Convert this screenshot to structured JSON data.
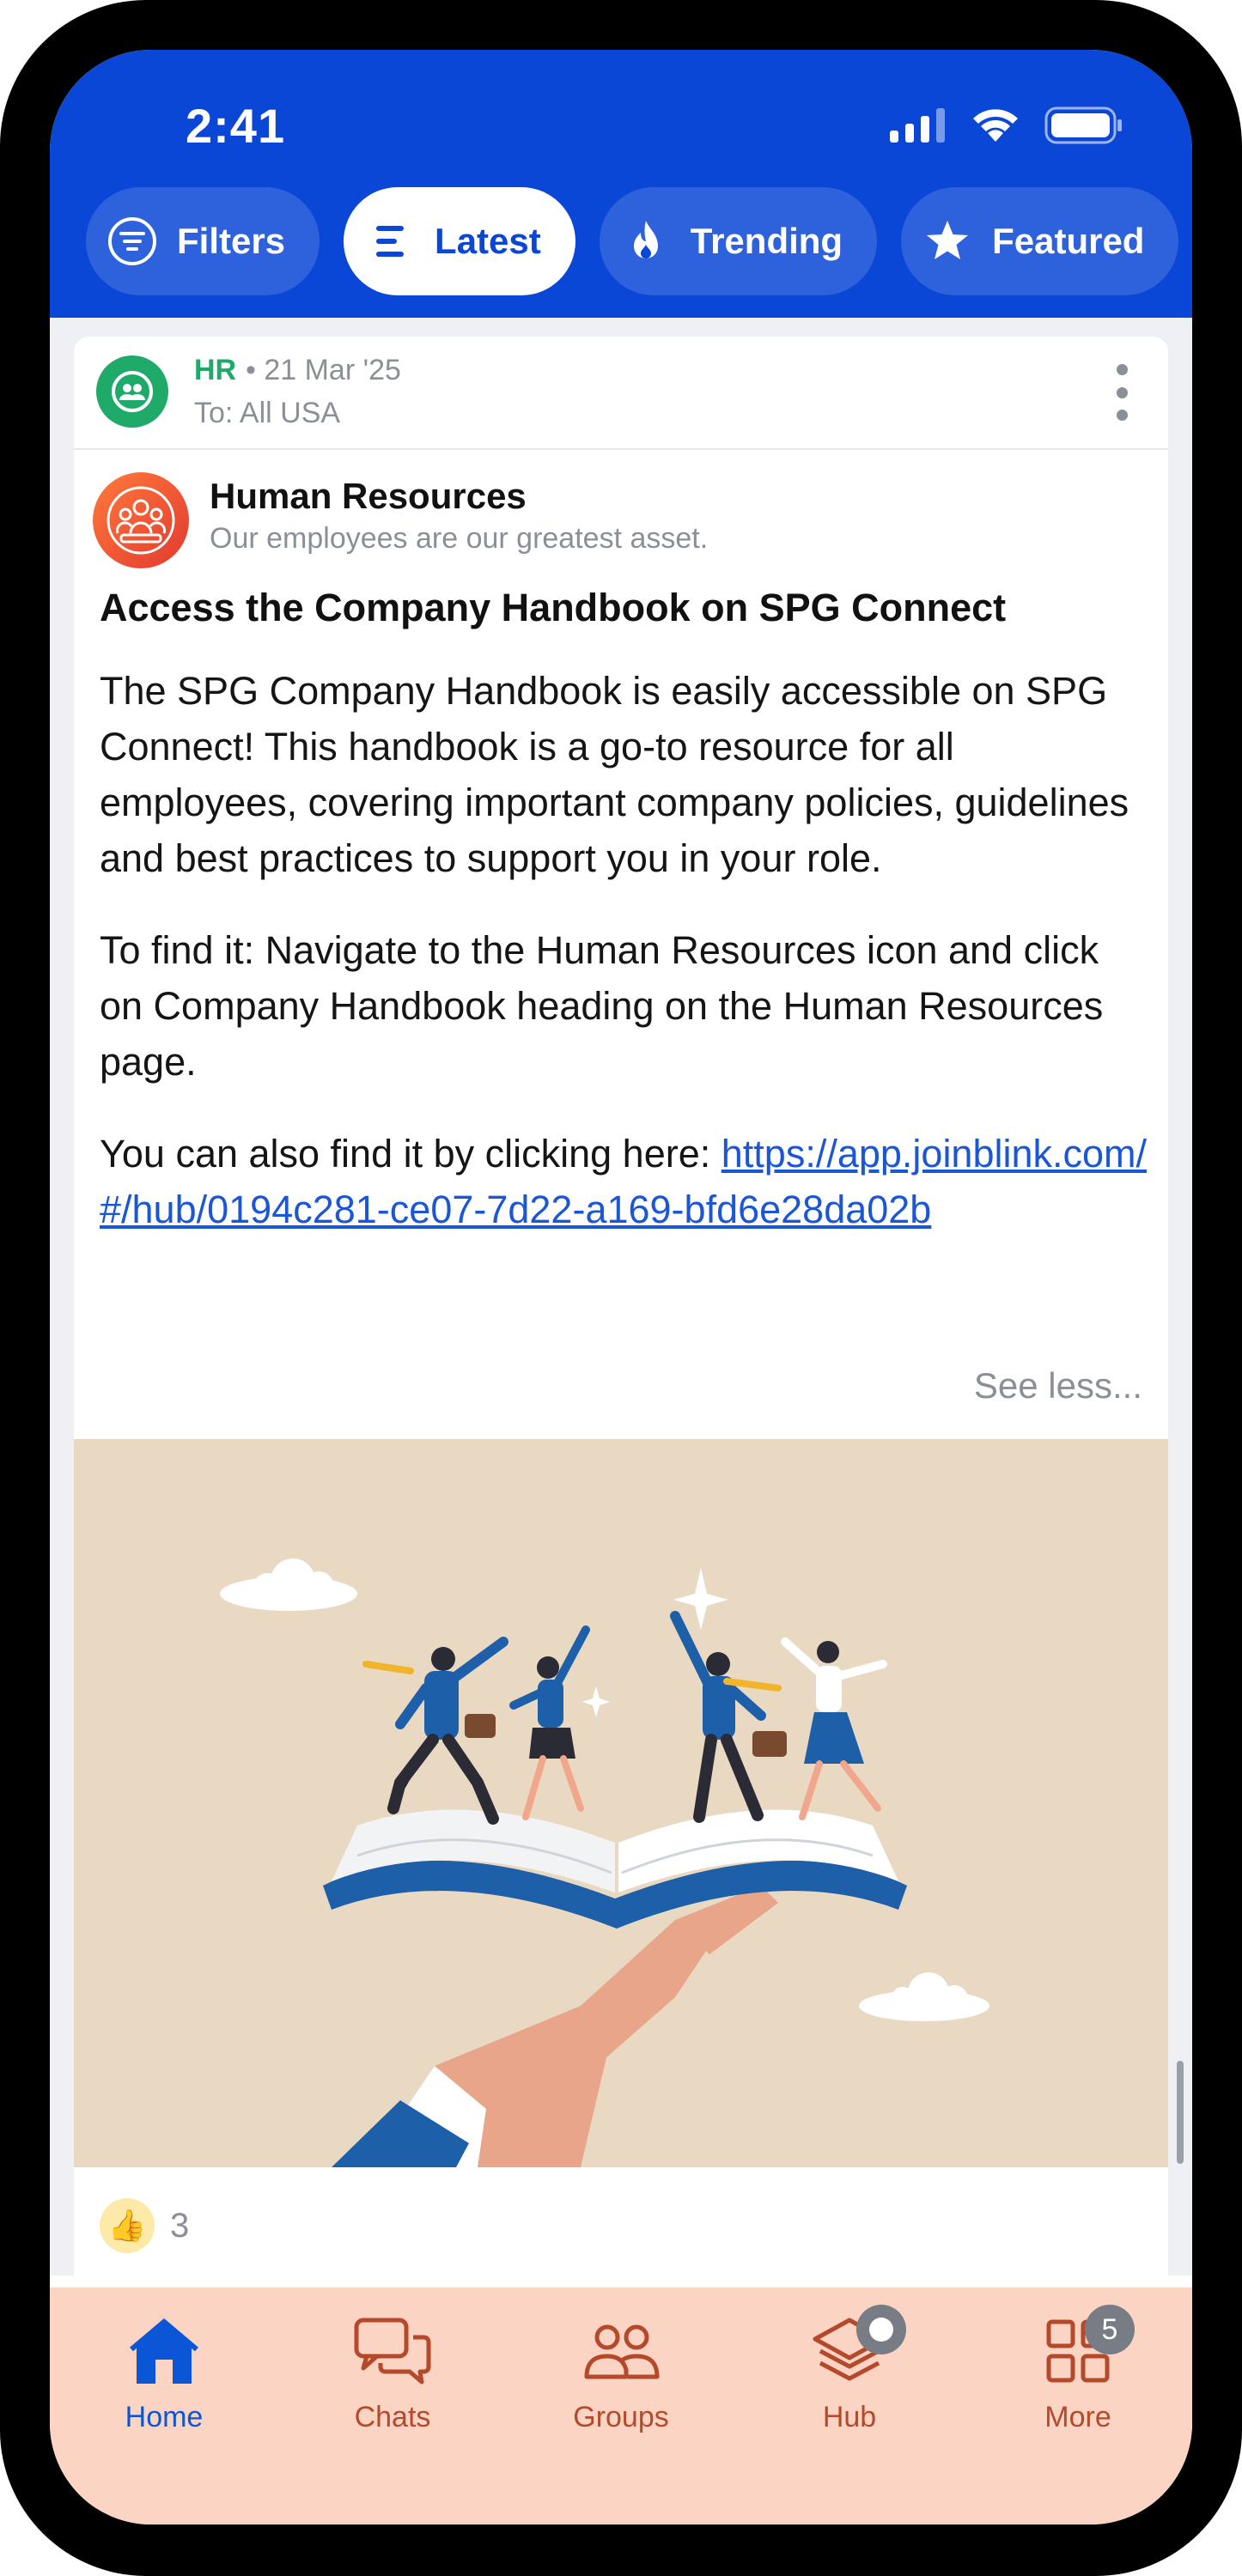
{
  "status_bar": {
    "time": "2:41"
  },
  "filters": [
    {
      "label": "Filters",
      "icon": "filter-icon",
      "active": false
    },
    {
      "label": "Latest",
      "icon": "list-icon",
      "active": true
    },
    {
      "label": "Trending",
      "icon": "flame-icon",
      "active": false
    },
    {
      "label": "Featured",
      "icon": "star-icon",
      "active": false
    }
  ],
  "post": {
    "channel": "HR",
    "date": "• 21 Mar '25",
    "audience": "To: All USA",
    "author_name": "Human Resources",
    "author_tagline": "Our employees are our greatest asset.",
    "title": "Access the Company Handbook on SPG Connect",
    "paragraph_1": "The SPG Company Handbook is easily accessible on SPG Connect! This handbook is a go-to resource for all employees, covering important company policies, guidelines and best practices to support you in your role.",
    "paragraph_2": "To find it: Navigate to the Human Resources icon and click on Company Handbook heading on the Human Resources page.",
    "paragraph_3_prefix": "You can also find it by clicking here: ",
    "link": "https://app.joinblink.com/#/hub/0194c281-ce07-7d22-a169-bfd6e28da02b",
    "see_less": "See less...",
    "reaction_count": "3"
  },
  "nav": {
    "items": [
      {
        "label": "Home",
        "icon": "home-icon",
        "active": true
      },
      {
        "label": "Chats",
        "icon": "chat-icon",
        "active": false
      },
      {
        "label": "Groups",
        "icon": "groups-icon",
        "active": false
      },
      {
        "label": "Hub",
        "icon": "layers-icon",
        "active": false
      },
      {
        "label": "More",
        "icon": "grid-icon",
        "active": false,
        "badge": "5"
      }
    ]
  },
  "colors": {
    "brand_blue": "#0a47d6",
    "nav_bg": "#fcd4c4",
    "nav_inactive": "#b5492b",
    "hr_green": "#1faa6a"
  }
}
